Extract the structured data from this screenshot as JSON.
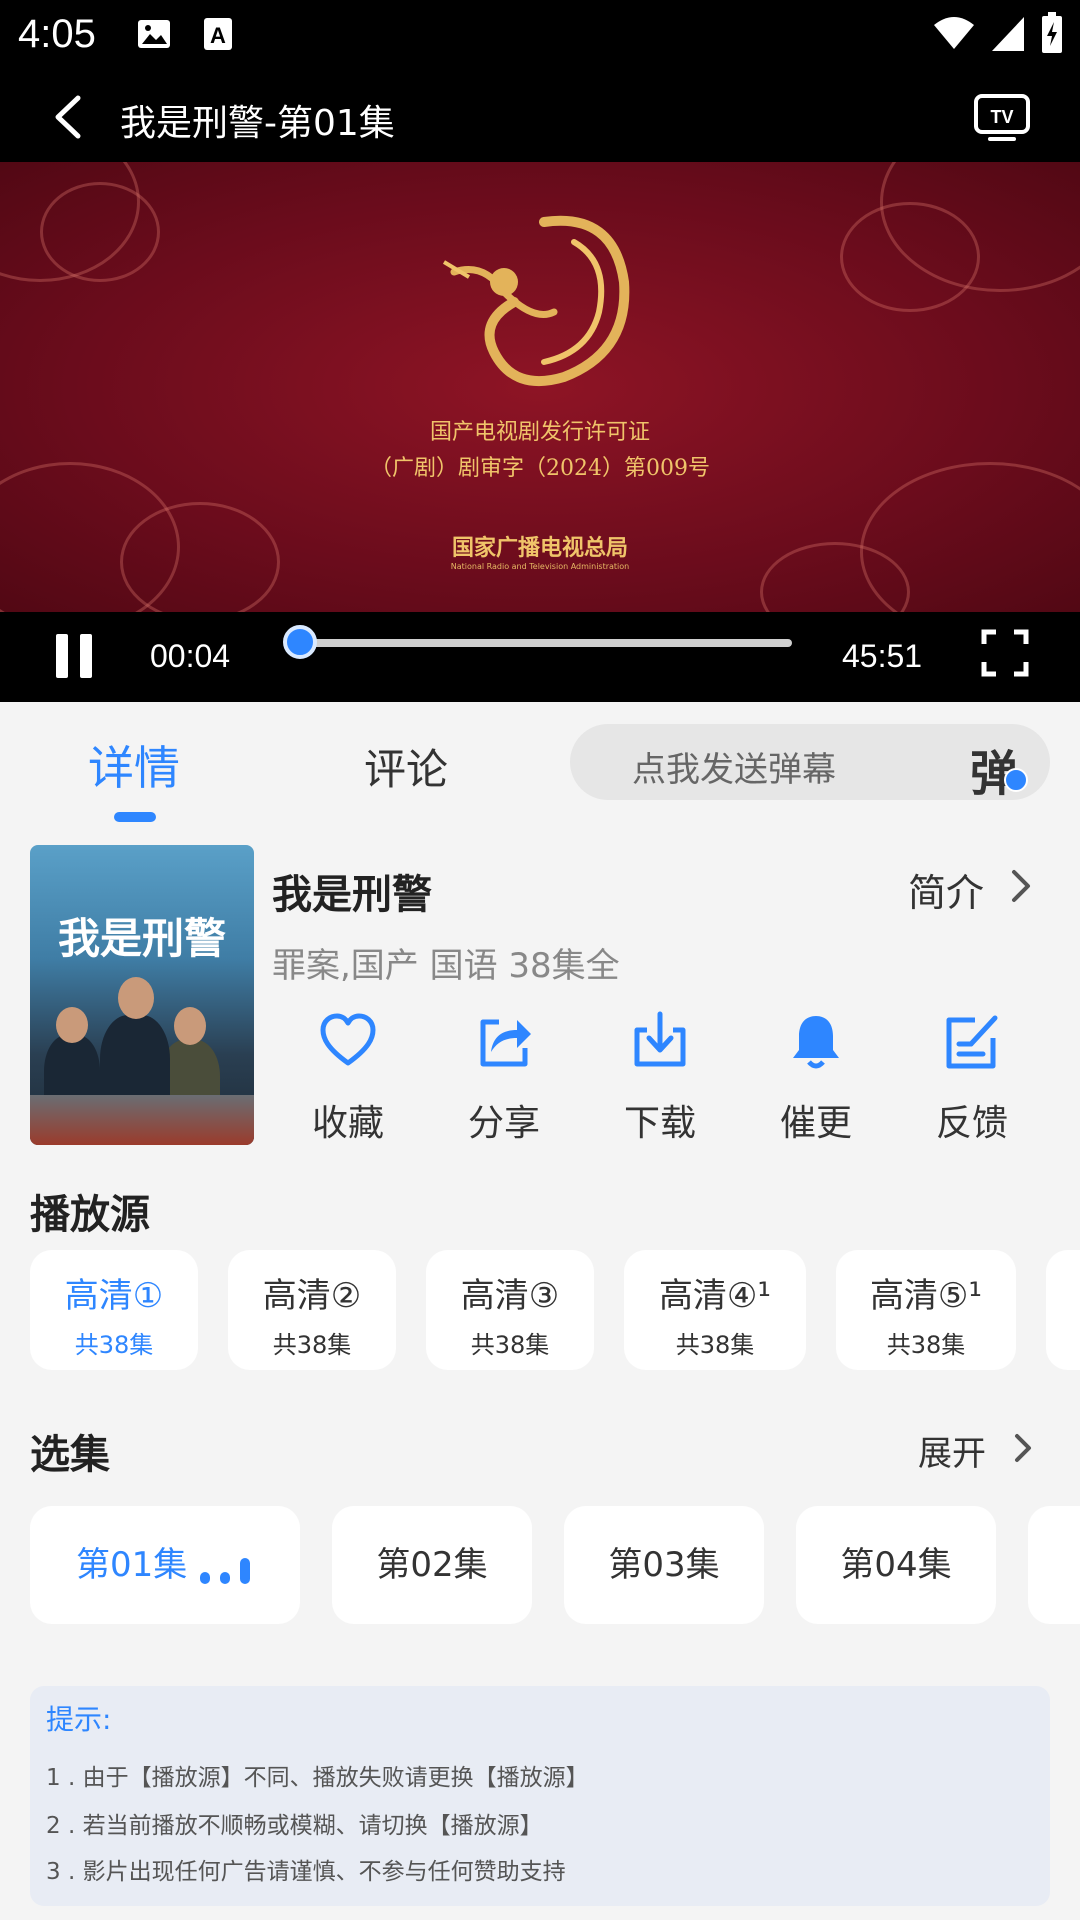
{
  "status": {
    "time": "4:05"
  },
  "titlebar": {
    "title": "我是刑警-第01集"
  },
  "video": {
    "license_line1": "国产电视剧发行许可证",
    "license_line2": "（广剧）剧审字（2024）第009号",
    "org": "国家广播电视总局",
    "org_en": "National Radio and Television Administration"
  },
  "player": {
    "current": "00:04",
    "duration": "45:51",
    "progress": 0.0015
  },
  "tabs": {
    "details": "详情",
    "comments": "评论",
    "danmu_placeholder": "点我发送弹幕",
    "danmu_icon_text": "弹"
  },
  "info": {
    "poster_title": "我是刑警",
    "title": "我是刑警",
    "intro": "简介",
    "meta": "罪案,国产 国语 38集全",
    "actions": [
      {
        "label": "收藏",
        "icon": "heart-icon"
      },
      {
        "label": "分享",
        "icon": "share-icon"
      },
      {
        "label": "下载",
        "icon": "download-icon"
      },
      {
        "label": "催更",
        "icon": "bell-icon"
      },
      {
        "label": "反馈",
        "icon": "feedback-icon"
      }
    ]
  },
  "sources": {
    "title": "播放源",
    "items": [
      {
        "name": "高清①",
        "count": "共38集"
      },
      {
        "name": "高清②",
        "count": "共38集"
      },
      {
        "name": "高清③",
        "count": "共38集"
      },
      {
        "name": "高清④¹",
        "count": "共38集"
      },
      {
        "name": "高清⑤¹",
        "count": "共38集"
      }
    ]
  },
  "episodes": {
    "title": "选集",
    "expand": "展开",
    "items": [
      "第01集",
      "第02集",
      "第03集",
      "第04集"
    ]
  },
  "tips": {
    "title": "提示:",
    "lines": [
      "1 . 由于【播放源】不同、播放失败请更换【播放源】",
      "2 . 若当前播放不顺畅或模糊、请切换【播放源】",
      "3 . 影片出现任何广告请谨慎、不参与任何赞助支持"
    ]
  },
  "colors": {
    "accent": "#2e86ff",
    "video_bg": "#7a0f20",
    "gold": "#f0c46a"
  }
}
